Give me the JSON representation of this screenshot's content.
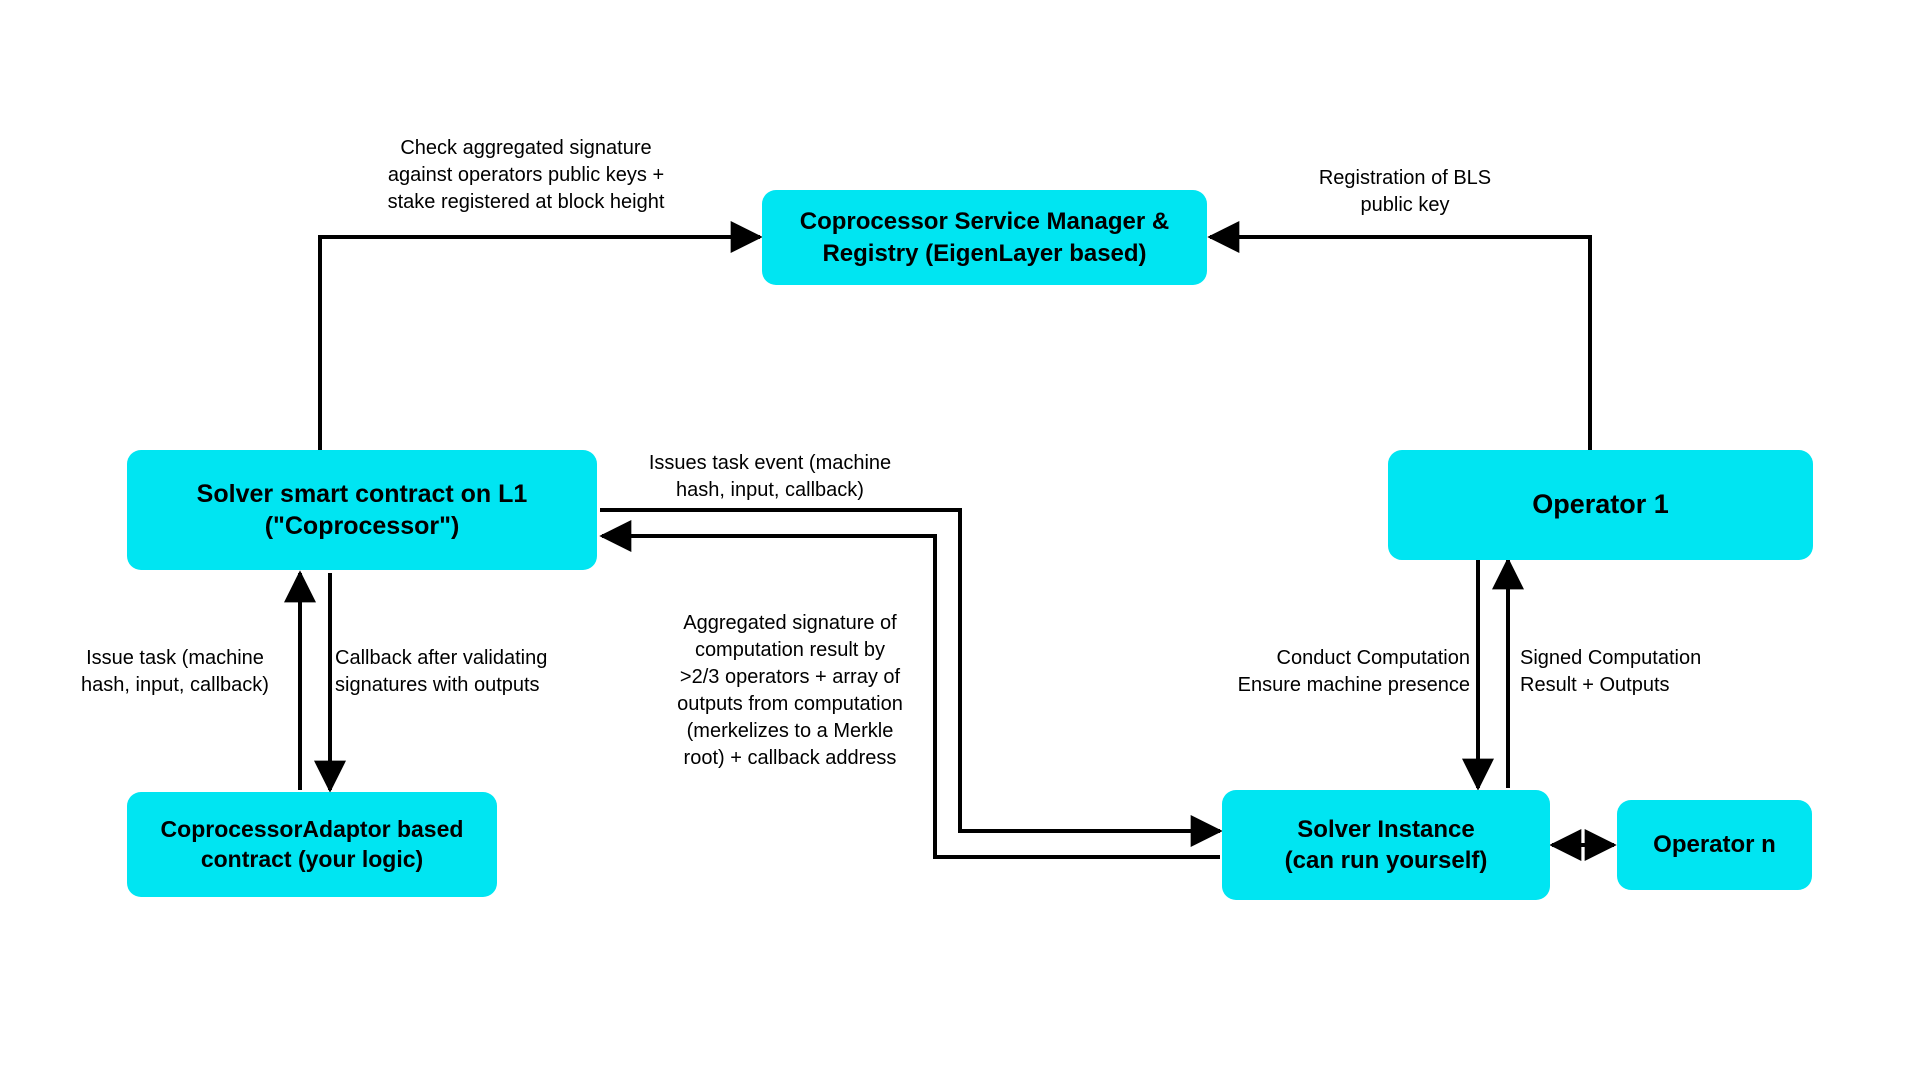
{
  "colors": {
    "node_fill": "#00e5f2",
    "text": "#000000",
    "arrow": "#000000"
  },
  "nodes": {
    "service_manager": {
      "line1": "Coprocessor Service Manager &",
      "line2": "Registry (EigenLayer based)"
    },
    "solver_contract": {
      "line1": "Solver smart contract on L1",
      "line2": "(\"Coprocessor\")"
    },
    "operator1": {
      "text": "Operator 1"
    },
    "adaptor_contract": {
      "line1": "CoprocessorAdaptor based",
      "line2": "contract (your logic)"
    },
    "solver_instance": {
      "line1": "Solver Instance",
      "line2": "(can run yourself)"
    },
    "operator_n": {
      "text": "Operator n"
    }
  },
  "edges": {
    "check_sig": {
      "line1": "Check aggregated signature",
      "line2": "against operators public keys +",
      "line3": "stake registered at block height"
    },
    "reg_bls": {
      "line1": "Registration of BLS",
      "line2": "public key"
    },
    "issue_task_event": {
      "line1": "Issues task event (machine",
      "line2": "hash, input, callback)"
    },
    "issue_task": {
      "line1": "Issue task (machine",
      "line2": "hash, input, callback)"
    },
    "callback_validate": {
      "line1": "Callback after validating",
      "line2": "signatures with outputs"
    },
    "agg_sig": {
      "line1": "Aggregated signature of",
      "line2": "computation result by",
      "line3": ">2/3 operators + array of",
      "line4": "outputs from computation",
      "line5": "(merkelizes to a Merkle",
      "line6": "root) + callback address"
    },
    "conduct_comp": {
      "line1": "Conduct Computation",
      "line2": "Ensure machine presence"
    },
    "signed_result": {
      "line1": "Signed Computation",
      "line2": "Result + Outputs"
    }
  }
}
